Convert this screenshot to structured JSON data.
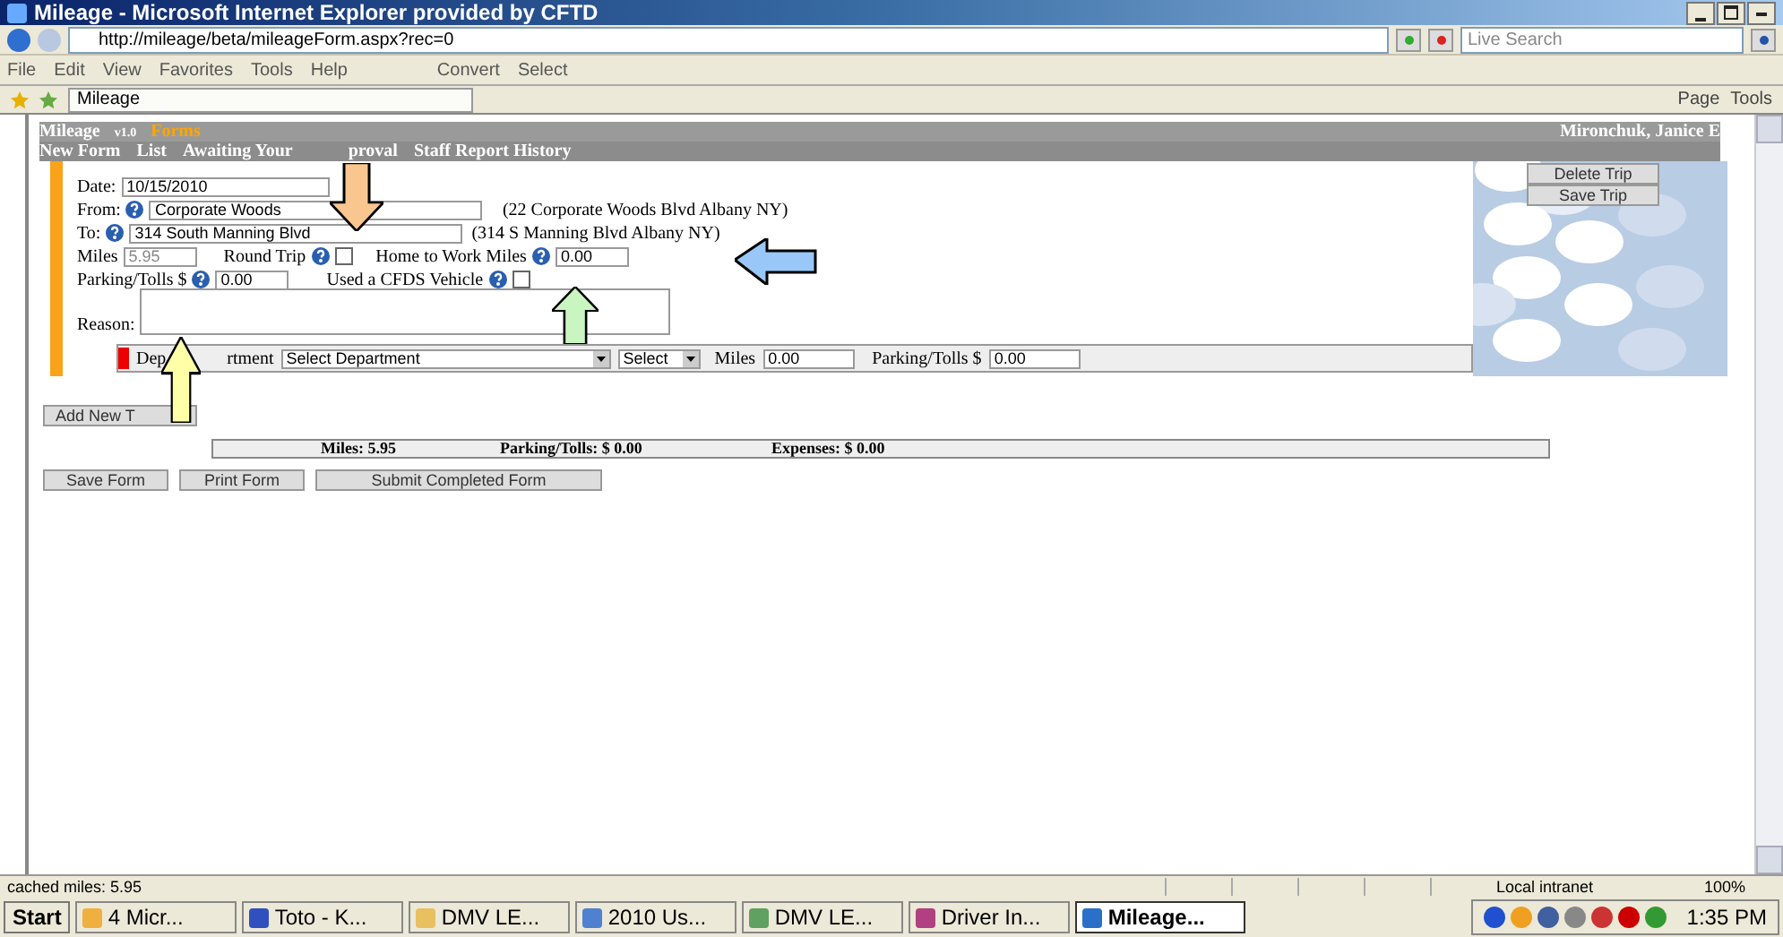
{
  "window": {
    "title": "Mileage - Microsoft Internet Explorer provided by CFTD"
  },
  "address_bar": {
    "url": "http://mileage/beta/mileageForm.aspx?rec=0",
    "search_placeholder": "Live Search"
  },
  "menu": [
    "File",
    "Edit",
    "View",
    "Favorites",
    "Tools",
    "Help"
  ],
  "toolbar_buttons": [
    "Convert",
    "Select"
  ],
  "tab": {
    "title": "Mileage"
  },
  "command_bar": [
    "Page",
    "Tools"
  ],
  "app": {
    "name": "Mileage",
    "version": "v1.0",
    "section": "Forms",
    "user": "Mironchuk, Janice E"
  },
  "nav": [
    "New Form",
    "List",
    "Awaiting Your",
    "proval",
    "Staff Report History"
  ],
  "form": {
    "date_label": "Date:",
    "date": "10/15/2010",
    "from_label": "From:",
    "from": "Corporate Woods",
    "from_address": "(22 Corporate Woods Blvd Albany NY)",
    "to_label": "To:",
    "to": "314 South Manning Blvd",
    "to_address": "(314 S Manning Blvd Albany NY)",
    "miles_label": "Miles",
    "miles": "5.95",
    "round_trip_label": "Round Trip",
    "round_trip": false,
    "home_label": "Home to Work Miles",
    "home_miles": "0.00",
    "parking_label": "Parking/Tolls $",
    "parking": "0.00",
    "cfds_label": "Used a CFDS Vehicle",
    "cfds": false,
    "reason_label": "Reason:"
  },
  "department_row": {
    "label_start": "Dep",
    "label_end": "rtment",
    "department": "Select Department",
    "select": "Select",
    "miles_label": "Miles",
    "miles": "0.00",
    "parking_label": "Parking/Tolls $",
    "parking": "0.00"
  },
  "trip_buttons": [
    "Delete Trip",
    "Save Trip"
  ],
  "add_trip_button": "Add New T",
  "totals": [
    "Miles: 5.95",
    "Parking/Tolls: $ 0.00",
    "Expenses: $ 0.00"
  ],
  "form_buttons": [
    "Save Form",
    "Print Form",
    "Submit Completed Form"
  ],
  "status_bar": {
    "text": "cached miles: 5.95",
    "zone": "Local intranet",
    "zoom": "100%"
  },
  "taskbar": {
    "start": "Start",
    "items": [
      {
        "label": "4 Micr...",
        "selected": false
      },
      {
        "label": "Toto - K...",
        "selected": false
      },
      {
        "label": "DMV LE...",
        "selected": false
      },
      {
        "label": "2010 Us...",
        "selected": false
      },
      {
        "label": "DMV LE...",
        "selected": false
      },
      {
        "label": "Driver In...",
        "selected": false
      },
      {
        "label": "Mileage...",
        "selected": true
      }
    ],
    "clock": "1:35 PM"
  }
}
